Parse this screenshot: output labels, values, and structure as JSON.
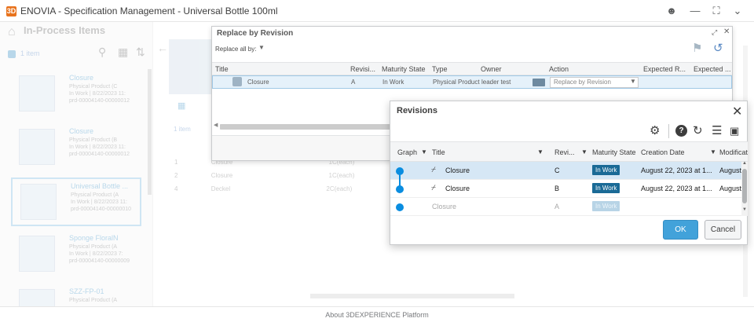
{
  "window": {
    "title": "ENOVIA - Specification Management - Universal Bottle 100ml",
    "logo_glyph": "3D"
  },
  "background": {
    "section_title": "In-Process Items",
    "item_count": "1 item",
    "cards": [
      {
        "title": "Closure",
        "lines": [
          "Physical Product (C",
          "In Work | 8/22/2023 11:",
          "prd-00004140-00000012"
        ]
      },
      {
        "title": "Closure",
        "lines": [
          "Physical Product (B",
          "In Work | 8/22/2023 11:",
          "prd-00004140-00000012"
        ]
      },
      {
        "title": "Universal Bottle ...",
        "lines": [
          "Physical Product (A",
          "In Work | 8/22/2023 11:",
          "prd-00004140-00000010"
        ]
      },
      {
        "title": "Sponge FloralN",
        "lines": [
          "Physical Product (A",
          "In Work | 8/22/2023 7:",
          "prd-00004140-00000009"
        ]
      },
      {
        "title": "SZZ-FP-01",
        "lines": [
          "Physical Product (A",
          "",
          ""
        ]
      }
    ],
    "center_count": "1 item",
    "center_rows": [
      {
        "num": "1",
        "name": "Closure",
        "rev": "1C(each)"
      },
      {
        "num": "2",
        "name": "Closure",
        "rev": "1C(each)"
      },
      {
        "num": "4",
        "name": "Deckel",
        "rev": "2C(each)"
      }
    ]
  },
  "replace_dialog": {
    "title": "Replace by Revision",
    "replace_all_label": "Replace all by:",
    "columns": [
      "Title",
      "Revisi...",
      "Maturity State",
      "Type",
      "Owner",
      "Action",
      "Expected R...",
      "Expected ..."
    ],
    "row": {
      "title": "Closure",
      "revision": "A",
      "maturity": "In Work",
      "type": "Physical Product",
      "owner": "leader test",
      "action": "Replace by Revision"
    }
  },
  "revisions_dialog": {
    "title": "Revisions",
    "columns": {
      "graph": "Graph",
      "title": "Title",
      "revision": "Revi...",
      "maturity": "Maturity State",
      "created": "Creation Date",
      "modified": "Modificat"
    },
    "rows": [
      {
        "title": "Closure",
        "revision": "C",
        "maturity": "In Work",
        "created": "August 22, 2023 at 1...",
        "modified": "August",
        "selected": true
      },
      {
        "title": "Closure",
        "revision": "B",
        "maturity": "In Work",
        "created": "August 22, 2023 at 1...",
        "modified": "August",
        "selected": false
      },
      {
        "title": "Closure",
        "revision": "A",
        "maturity": "In Work",
        "created": "",
        "modified": "",
        "selected": false
      }
    ],
    "ok_label": "OK",
    "cancel_label": "Cancel"
  },
  "footer": {
    "link_text": "About 3DEXPERIENCE Platform"
  },
  "colors": {
    "accent": "#42a2da",
    "badge": "#1a6a96",
    "graph_dot": "#0a8de0",
    "selected_row": "#d6e7f5"
  }
}
